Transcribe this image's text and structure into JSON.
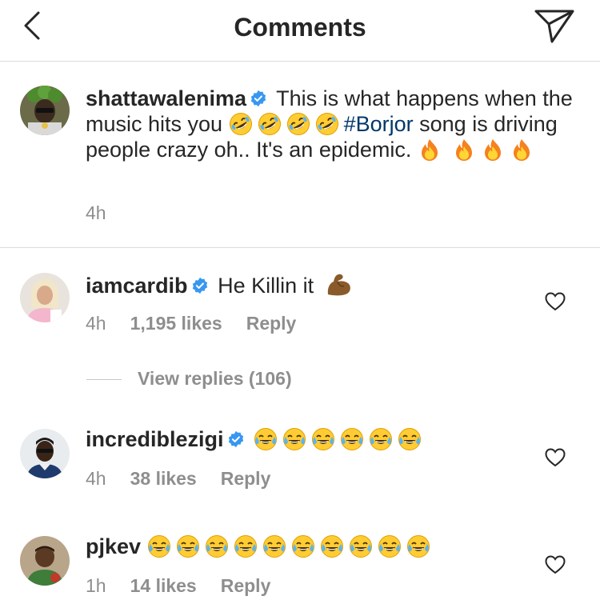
{
  "header": {
    "title": "Comments"
  },
  "post": {
    "username": "shattawalenima",
    "text_1": "This is what happens when the music hits you",
    "hashtag": "#Borjor",
    "text_2": "song is driving people crazy oh.. It's an epidemic.",
    "time": "4h"
  },
  "comments": [
    {
      "username": "iamcardib",
      "text": "He Killin it",
      "time": "4h",
      "likes": "1,195 likes",
      "reply": "Reply",
      "view_replies": "View replies (106)"
    },
    {
      "username": "incrediblezigi",
      "time": "4h",
      "likes": "38 likes",
      "reply": "Reply"
    },
    {
      "username": "pjkev",
      "time": "1h",
      "likes": "14 likes",
      "reply": "Reply"
    }
  ],
  "icons": {
    "back": "chevron-left-icon",
    "send": "send-icon",
    "verified": "verified-badge-icon",
    "like": "heart-outline-icon"
  },
  "colors": {
    "verified": "#3897f0",
    "hashtag": "#00376b",
    "meta": "#8e8e8e"
  }
}
